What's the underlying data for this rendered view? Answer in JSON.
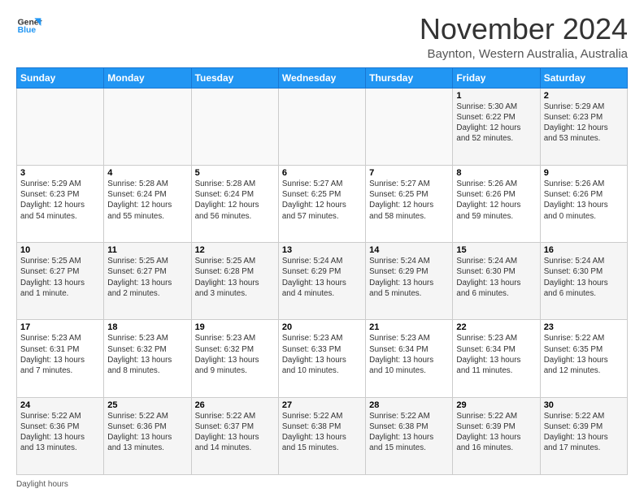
{
  "logo": {
    "line1": "General",
    "line2": "Blue"
  },
  "title": "November 2024",
  "location": "Baynton, Western Australia, Australia",
  "weekdays": [
    "Sunday",
    "Monday",
    "Tuesday",
    "Wednesday",
    "Thursday",
    "Friday",
    "Saturday"
  ],
  "weeks": [
    [
      {
        "day": "",
        "info": ""
      },
      {
        "day": "",
        "info": ""
      },
      {
        "day": "",
        "info": ""
      },
      {
        "day": "",
        "info": ""
      },
      {
        "day": "",
        "info": ""
      },
      {
        "day": "1",
        "info": "Sunrise: 5:30 AM\nSunset: 6:22 PM\nDaylight: 12 hours\nand 52 minutes."
      },
      {
        "day": "2",
        "info": "Sunrise: 5:29 AM\nSunset: 6:23 PM\nDaylight: 12 hours\nand 53 minutes."
      }
    ],
    [
      {
        "day": "3",
        "info": "Sunrise: 5:29 AM\nSunset: 6:23 PM\nDaylight: 12 hours\nand 54 minutes."
      },
      {
        "day": "4",
        "info": "Sunrise: 5:28 AM\nSunset: 6:24 PM\nDaylight: 12 hours\nand 55 minutes."
      },
      {
        "day": "5",
        "info": "Sunrise: 5:28 AM\nSunset: 6:24 PM\nDaylight: 12 hours\nand 56 minutes."
      },
      {
        "day": "6",
        "info": "Sunrise: 5:27 AM\nSunset: 6:25 PM\nDaylight: 12 hours\nand 57 minutes."
      },
      {
        "day": "7",
        "info": "Sunrise: 5:27 AM\nSunset: 6:25 PM\nDaylight: 12 hours\nand 58 minutes."
      },
      {
        "day": "8",
        "info": "Sunrise: 5:26 AM\nSunset: 6:26 PM\nDaylight: 12 hours\nand 59 minutes."
      },
      {
        "day": "9",
        "info": "Sunrise: 5:26 AM\nSunset: 6:26 PM\nDaylight: 13 hours\nand 0 minutes."
      }
    ],
    [
      {
        "day": "10",
        "info": "Sunrise: 5:25 AM\nSunset: 6:27 PM\nDaylight: 13 hours\nand 1 minute."
      },
      {
        "day": "11",
        "info": "Sunrise: 5:25 AM\nSunset: 6:27 PM\nDaylight: 13 hours\nand 2 minutes."
      },
      {
        "day": "12",
        "info": "Sunrise: 5:25 AM\nSunset: 6:28 PM\nDaylight: 13 hours\nand 3 minutes."
      },
      {
        "day": "13",
        "info": "Sunrise: 5:24 AM\nSunset: 6:29 PM\nDaylight: 13 hours\nand 4 minutes."
      },
      {
        "day": "14",
        "info": "Sunrise: 5:24 AM\nSunset: 6:29 PM\nDaylight: 13 hours\nand 5 minutes."
      },
      {
        "day": "15",
        "info": "Sunrise: 5:24 AM\nSunset: 6:30 PM\nDaylight: 13 hours\nand 6 minutes."
      },
      {
        "day": "16",
        "info": "Sunrise: 5:24 AM\nSunset: 6:30 PM\nDaylight: 13 hours\nand 6 minutes."
      }
    ],
    [
      {
        "day": "17",
        "info": "Sunrise: 5:23 AM\nSunset: 6:31 PM\nDaylight: 13 hours\nand 7 minutes."
      },
      {
        "day": "18",
        "info": "Sunrise: 5:23 AM\nSunset: 6:32 PM\nDaylight: 13 hours\nand 8 minutes."
      },
      {
        "day": "19",
        "info": "Sunrise: 5:23 AM\nSunset: 6:32 PM\nDaylight: 13 hours\nand 9 minutes."
      },
      {
        "day": "20",
        "info": "Sunrise: 5:23 AM\nSunset: 6:33 PM\nDaylight: 13 hours\nand 10 minutes."
      },
      {
        "day": "21",
        "info": "Sunrise: 5:23 AM\nSunset: 6:34 PM\nDaylight: 13 hours\nand 10 minutes."
      },
      {
        "day": "22",
        "info": "Sunrise: 5:23 AM\nSunset: 6:34 PM\nDaylight: 13 hours\nand 11 minutes."
      },
      {
        "day": "23",
        "info": "Sunrise: 5:22 AM\nSunset: 6:35 PM\nDaylight: 13 hours\nand 12 minutes."
      }
    ],
    [
      {
        "day": "24",
        "info": "Sunrise: 5:22 AM\nSunset: 6:36 PM\nDaylight: 13 hours\nand 13 minutes."
      },
      {
        "day": "25",
        "info": "Sunrise: 5:22 AM\nSunset: 6:36 PM\nDaylight: 13 hours\nand 13 minutes."
      },
      {
        "day": "26",
        "info": "Sunrise: 5:22 AM\nSunset: 6:37 PM\nDaylight: 13 hours\nand 14 minutes."
      },
      {
        "day": "27",
        "info": "Sunrise: 5:22 AM\nSunset: 6:38 PM\nDaylight: 13 hours\nand 15 minutes."
      },
      {
        "day": "28",
        "info": "Sunrise: 5:22 AM\nSunset: 6:38 PM\nDaylight: 13 hours\nand 15 minutes."
      },
      {
        "day": "29",
        "info": "Sunrise: 5:22 AM\nSunset: 6:39 PM\nDaylight: 13 hours\nand 16 minutes."
      },
      {
        "day": "30",
        "info": "Sunrise: 5:22 AM\nSunset: 6:39 PM\nDaylight: 13 hours\nand 17 minutes."
      }
    ]
  ],
  "footer": "Daylight hours"
}
